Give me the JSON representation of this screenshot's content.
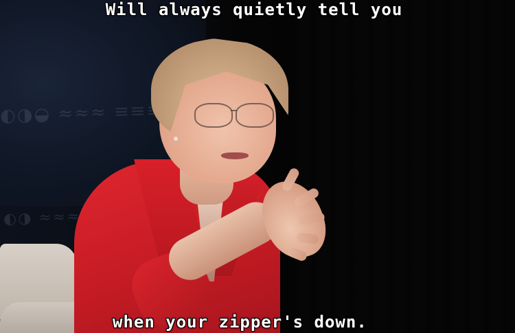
{
  "meme": {
    "top_text": "Will always quietly tell you",
    "bottom_text": "when your zipper's down."
  },
  "colors": {
    "caption_text": "#ffffff",
    "caption_outline": "#000000",
    "jacket": "#d21f28",
    "backdrop_navy": "#142036",
    "stage_black": "#050505",
    "chair": "#cfc7bd"
  }
}
